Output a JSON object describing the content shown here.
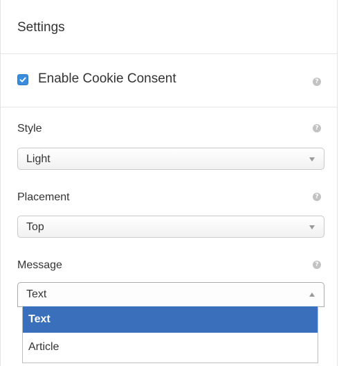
{
  "panel": {
    "title": "Settings"
  },
  "consent": {
    "label": "Enable Cookie Consent",
    "checked": true,
    "help_icon": "question-circle-icon"
  },
  "fields": {
    "style": {
      "label": "Style",
      "value": "Light",
      "help_icon": "question-circle-icon"
    },
    "placement": {
      "label": "Placement",
      "value": "Top",
      "help_icon": "question-circle-icon"
    },
    "message": {
      "label": "Message",
      "value": "Text",
      "help_icon": "question-circle-icon",
      "open": true,
      "options": [
        "Text",
        "Article"
      ],
      "highlighted": "Text"
    }
  },
  "colors": {
    "accent": "#3b8ddb",
    "highlight": "#3a6fbc"
  }
}
